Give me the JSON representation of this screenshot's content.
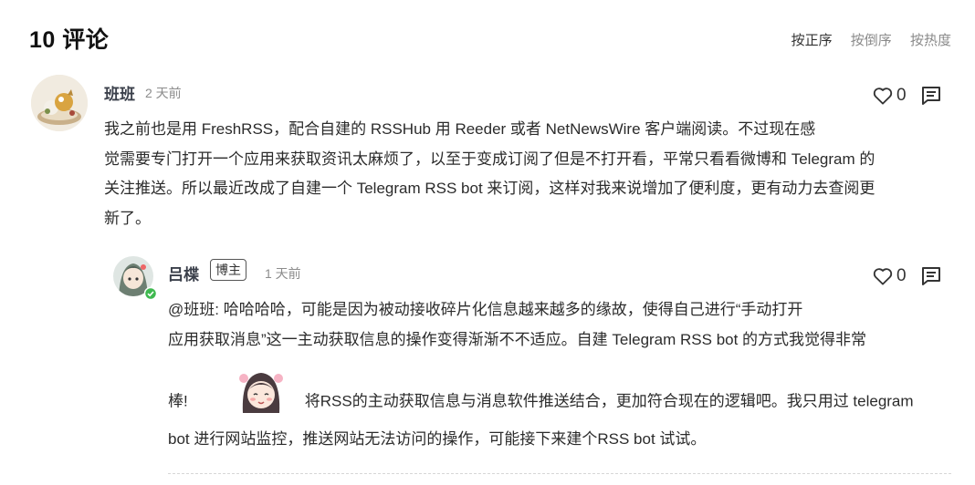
{
  "header": {
    "title": "10 评论",
    "sort": [
      "按正序",
      "按倒序",
      "按热度"
    ]
  },
  "comments": [
    {
      "author": "班班",
      "time": "2 天前",
      "likes": "0",
      "lines": [
        "我之前也是用 FreshRSS，配合自建的 RSSHub 用 Reeder 或者 NetNewsWire 客户端阅读。不过现在感",
        "觉需要专门打开一个应用来获取资讯太麻烦了，以至于变成订阅了但是不打开看，平常只看看微博和 Telegram 的",
        "关注推送。所以最近改成了自建一个 Telegram RSS bot 来订阅，这样对我来说增加了便利度，更有动力去查阅更",
        "新了。"
      ]
    },
    {
      "author": "吕楪",
      "badge": "博主",
      "time": "1 天前",
      "likes": "0",
      "lines": [
        "@班班: 哈哈哈哈，可能是因为被动接收碎片化信息越来越多的缘故，使得自己进行“手动打开",
        "应用获取消息”这一主动获取信息的操作变得渐渐不不适应。自建 Telegram RSS bot 的方式我觉得非常"
      ],
      "line3_before": "棒!",
      "line3_after": "将RSS的主动获取信息与消息软件推送结合，更加符合现在的逻辑吧。我只用过 telegram",
      "line4": "bot 进行网站监控，推送网站无法访问的操作，可能接下来建个RSS bot 试试。"
    }
  ],
  "colors": {
    "text": "#2b2b2b",
    "muted": "#8c8c8c",
    "online": "#3fb950"
  },
  "icons": {
    "like": "heart-outline-icon",
    "reply": "comment-bubble-icon",
    "sticker": "anime-girl-sticker"
  }
}
